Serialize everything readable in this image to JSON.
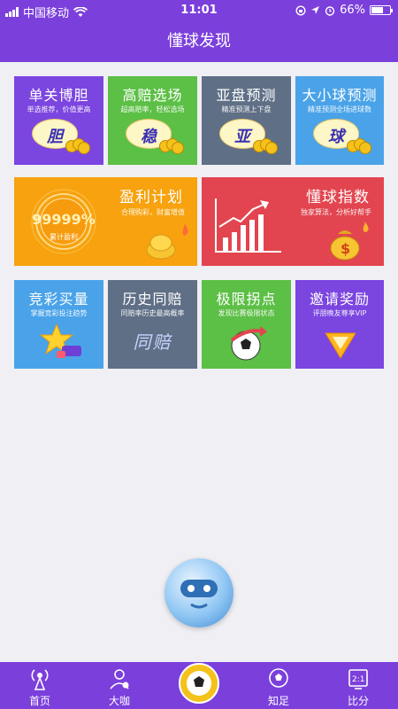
{
  "status_bar": {
    "carrier": "中国移动",
    "time": "11:01",
    "battery_percent": "66%",
    "battery_level": 0.66
  },
  "nav": {
    "title": "懂球发现"
  },
  "row1": [
    {
      "title": "单关博胆",
      "subtitle": "单选推荐，价值更高",
      "glyph": "胆",
      "color": "#7b45e0"
    },
    {
      "title": "高赔选场",
      "subtitle": "超高赔率，轻松选场",
      "glyph": "稳",
      "color": "#5cbf46"
    },
    {
      "title": "亚盘预测",
      "subtitle": "精准预测上下盘",
      "glyph": "亚",
      "color": "#5f6f86"
    },
    {
      "title": "大小球预测",
      "subtitle": "精准预测全场进球数",
      "glyph": "球",
      "color": "#4aa3e8"
    }
  ],
  "row2": [
    {
      "title": "盈利计划",
      "subtitle": "合理购彩，财富增值",
      "ring_value": "99999%",
      "ring_label": "累计盈利",
      "color": "#f7a20e"
    },
    {
      "title": "懂球指数",
      "subtitle": "独家算法，分析好帮手",
      "color": "#e2454f"
    }
  ],
  "row3": [
    {
      "title": "竞彩买量",
      "subtitle": "掌握竞彩投注趋势",
      "color": "#4aa3e8"
    },
    {
      "title": "历史同赔",
      "subtitle": "同赔率历史最高概率",
      "glyph": "同赔",
      "color": "#5f6f86"
    },
    {
      "title": "极限拐点",
      "subtitle": "发现比赛极限状态",
      "color": "#5cbf46"
    },
    {
      "title": "邀请奖励",
      "subtitle": "评朋晚友尊享VIP",
      "color": "#7b45e0"
    }
  ],
  "tabbar": {
    "items": [
      {
        "label": "首页",
        "icon": "broadcast-icon"
      },
      {
        "label": "大咖",
        "icon": "expert-user-icon"
      },
      {
        "label": "",
        "icon": "center-mascot-icon"
      },
      {
        "label": "知足",
        "icon": "football-knowledge-icon"
      },
      {
        "label": "比分",
        "icon": "scoreboard-icon"
      }
    ]
  }
}
